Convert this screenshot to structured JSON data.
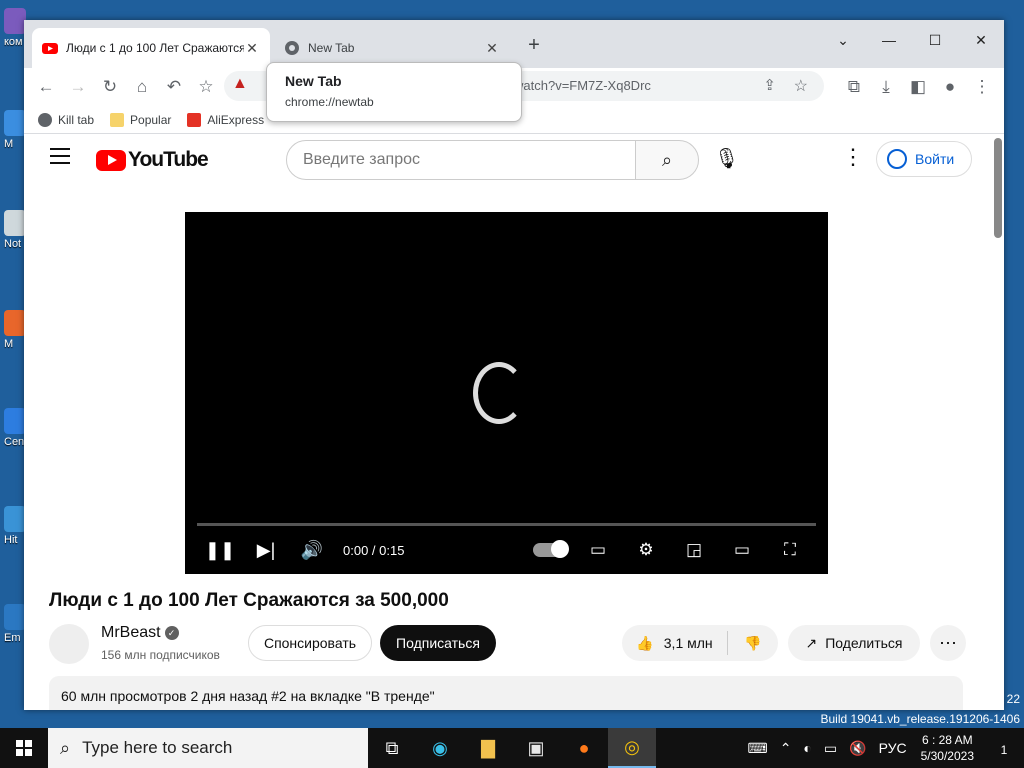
{
  "desktop": {
    "icons": [
      {
        "label": "ком"
      },
      {
        "label": "M"
      },
      {
        "label": "Not"
      },
      {
        "label": "M"
      },
      {
        "label": "Cen"
      },
      {
        "label": "Hit"
      },
      {
        "label": "Em"
      }
    ]
  },
  "browser": {
    "tabs": [
      {
        "title": "Люди с 1 до 100 Лет Сражаются",
        "close": "✕"
      },
      {
        "title": "New Tab",
        "close": "✕"
      }
    ],
    "new_tab_symbol": "+",
    "window_controls": [
      "⌄",
      "—",
      "☐",
      "✕"
    ],
    "url": "watch?v=FM7Z-Xq8Drc",
    "bookmarks": [
      {
        "label": "Kill tab",
        "color": "#5f6368"
      },
      {
        "label": "Popular",
        "color": "#f6d36b"
      },
      {
        "label": "AliExpress",
        "color": "#e43225"
      }
    ],
    "tooltip": {
      "title": "New Tab",
      "url": "chrome://newtab"
    }
  },
  "youtube": {
    "logo_text": "YouTube",
    "search_placeholder": "Введите запрос",
    "signin_label": "Войти",
    "player": {
      "time": "0:00 / 0:15"
    },
    "video_title": "Люди с 1 до 100 Лет Сражаются за 500,000",
    "channel_name": "MrBeast",
    "verified_mark": "✓",
    "subscribers": "156 млн подписчиков",
    "sponsor_label": "Спонсировать",
    "subscribe_label": "Подписаться",
    "likes": "3,1 млн",
    "share_label": "Поделиться",
    "description_meta": "60 млн просмотров  2 дня назад  #2 на вкладке \"В тренде\""
  },
  "system": {
    "build": "Build 19041.vb_release.191206-1406",
    "corner_number": "22",
    "taskbar_search": "Type here to search",
    "language": "РУС",
    "time": "6 : 28 AM",
    "date": "5/30/2023",
    "notif_count": "1"
  },
  "colors": {
    "youtube_red": "#ff0000",
    "accent_blue": "#065fd4",
    "taskbar": "#111111"
  }
}
